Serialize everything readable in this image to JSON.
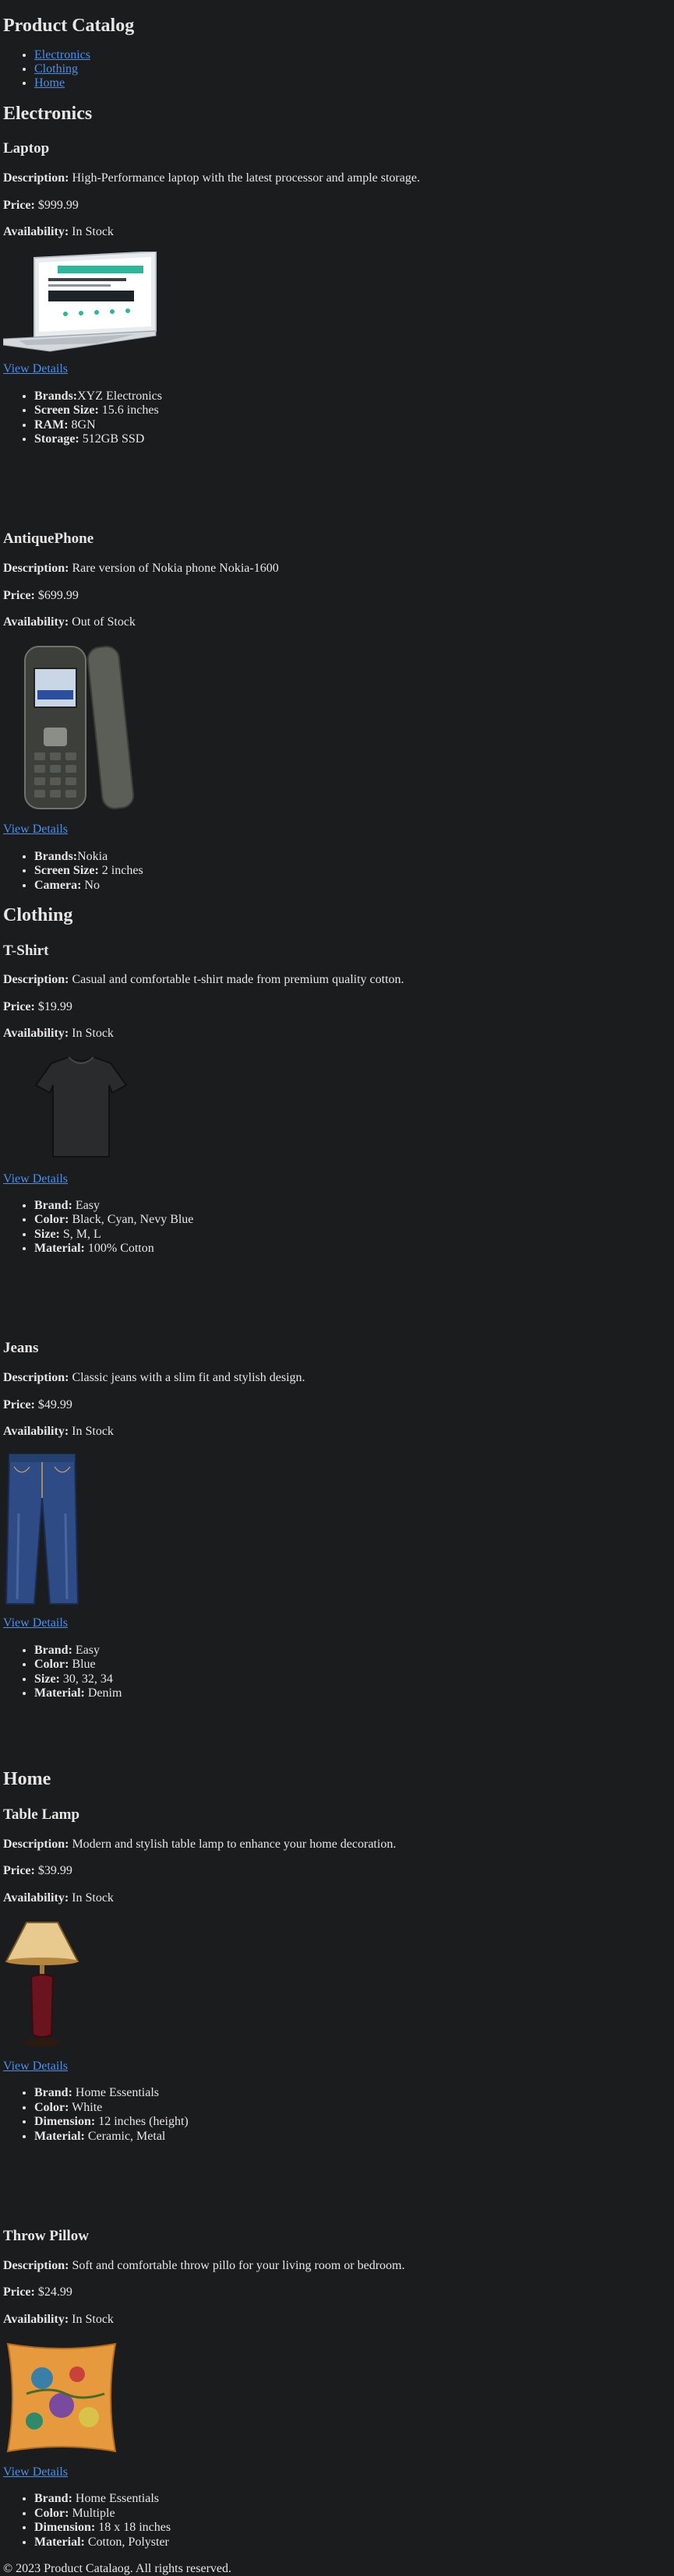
{
  "page_title": "Product Catalog",
  "nav": [
    "Electronics",
    "Clothing",
    "Home"
  ],
  "labels": {
    "description": "Description:",
    "price": "Price:",
    "availability": "Availability:",
    "view_details": "View Details"
  },
  "sections": [
    {
      "title": "Electronics",
      "products": [
        {
          "name": "Laptop",
          "description": "High-Performance laptop with the latest processor and ample storage.",
          "price": "$999.99",
          "availability": "In Stock",
          "image": "laptop-image",
          "specs": [
            {
              "label": "Brands:",
              "value": "XYZ Electronics"
            },
            {
              "label": "Screen Size:",
              "value": "15.6 inches"
            },
            {
              "label": "RAM:",
              "value": "8GN"
            },
            {
              "label": "Storage:",
              "value": "512GB SSD"
            }
          ]
        },
        {
          "name": "AntiquePhone",
          "description": "Rare version of Nokia phone Nokia-1600",
          "price": "$699.99",
          "availability": "Out of Stock",
          "image": "nokia-phone-image",
          "specs": [
            {
              "label": "Brands:",
              "value": "Nokia"
            },
            {
              "label": "Screen Size:",
              "value": "2 inches"
            },
            {
              "label": "Camera:",
              "value": "No"
            }
          ]
        }
      ]
    },
    {
      "title": "Clothing",
      "products": [
        {
          "name": "T-Shirt",
          "description": "Casual and comfortable t-shirt made from premium quality cotton.",
          "price": "$19.99",
          "availability": "In Stock",
          "image": "tshirt-image",
          "specs": [
            {
              "label": "Brand:",
              "value": "Easy"
            },
            {
              "label": "Color:",
              "value": "Black, Cyan, Nevy Blue"
            },
            {
              "label": "Size:",
              "value": "S, M, L"
            },
            {
              "label": "Material:",
              "value": "100% Cotton"
            }
          ]
        },
        {
          "name": "Jeans",
          "description": "Classic jeans with a slim fit and stylish design.",
          "price": "$49.99",
          "availability": "In Stock",
          "image": "jeans-image",
          "specs": [
            {
              "label": "Brand:",
              "value": "Easy"
            },
            {
              "label": "Color:",
              "value": "Blue"
            },
            {
              "label": "Size:",
              "value": "30, 32, 34"
            },
            {
              "label": "Material:",
              "value": "Denim"
            }
          ]
        }
      ]
    },
    {
      "title": "Home",
      "products": [
        {
          "name": "Table Lamp",
          "description": "Modern and stylish table lamp to enhance your home decoration.",
          "price": "$39.99",
          "availability": "In Stock",
          "image": "table-lamp-image",
          "specs": [
            {
              "label": "Brand:",
              "value": "Home Essentials"
            },
            {
              "label": "Color:",
              "value": "White"
            },
            {
              "label": "Dimension:",
              "value": "12 inches (height)"
            },
            {
              "label": "Material:",
              "value": "Ceramic, Metal"
            }
          ]
        },
        {
          "name": "Throw Pillow",
          "description": "Soft and comfortable throw pillo for your living room or bedroom.",
          "price": "$24.99",
          "availability": "In Stock",
          "image": "throw-pillow-image",
          "specs": [
            {
              "label": "Brand:",
              "value": "Home Essentials"
            },
            {
              "label": "Color:",
              "value": "Multiple"
            },
            {
              "label": "Dimension:",
              "value": "18 x 18 inches"
            },
            {
              "label": "Material:",
              "value": "Cotton, Polyster"
            }
          ]
        }
      ]
    }
  ],
  "footer": "© 2023 Product Catalaog. All rights reserved."
}
